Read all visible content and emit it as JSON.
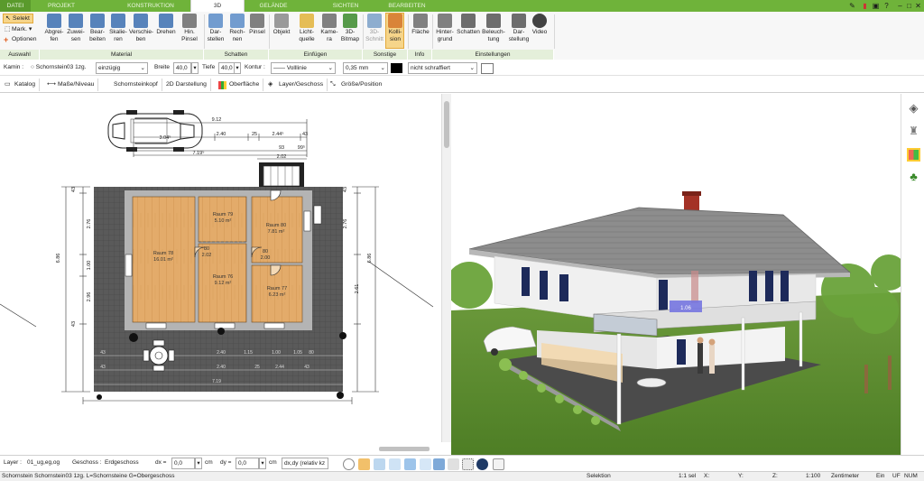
{
  "tabs": [
    "DATEI",
    "PROJEKT",
    "KONSTRUKTION",
    "3D",
    "GELÄNDE",
    "SICHTEN",
    "BEARBEITEN"
  ],
  "active_tab": "3D",
  "ribbon": {
    "auswahl": {
      "select": "Selekt",
      "mark": "Mark.",
      "options": "Optionen",
      "label": "Auswahl"
    },
    "material": {
      "label": "Material",
      "buttons": [
        "Abgrei-\nfen",
        "Zuwei-\nsen",
        "Bear-\nbeiten",
        "Skalie-\nren",
        "Verschie-\nben",
        "Drehen",
        "Hin.\nPinsel"
      ]
    },
    "schatten": {
      "label": "Schatten",
      "buttons": [
        "Dar-\nstellen",
        "Rech-\nnen",
        "Pinsel"
      ]
    },
    "einfuegen": {
      "label": "Einfügen",
      "buttons": [
        "Objekt",
        "Licht-\nquelle",
        "Kame-\nra",
        "3D-\nBitmap"
      ]
    },
    "sonstige": {
      "label": "Sonstige",
      "buttons": [
        "3D-\nSchnitt",
        "Kolli-\nsion"
      ]
    },
    "info": {
      "label": "Info",
      "buttons": [
        "Fläche"
      ]
    },
    "einstellungen": {
      "label": "Einstellungen",
      "buttons": [
        "Hinter-\ngrund",
        "Schatten",
        "Beleuch-\ntung",
        "Dar-\nstellung",
        "Video"
      ]
    }
  },
  "propbar": {
    "kamin_label": "Kamin :",
    "kamin_value": "Schornstein03 1zg.",
    "zug_value": "einzügig",
    "breite_label": "Breite",
    "breite_value": "40,0",
    "tiefe_label": "Tiefe",
    "tiefe_value": "40,0",
    "kontur_label": "Kontur :",
    "line_style": "Volllinie",
    "line_width": "0,35 mm",
    "fill": "nicht schraffiert"
  },
  "toolbar2": [
    "Katalog",
    "Maße/Niveau",
    "Schornsteinkopf",
    "2D Darstellung",
    "Oberfläche",
    "Layer/Geschoss",
    "Größe/Position"
  ],
  "plan": {
    "dims_top": [
      "9.12",
      "2.40",
      "25",
      "2.44⁵",
      "43",
      "7.19⁵",
      "93",
      "99⁵",
      "2.02"
    ],
    "car_dim": "3.04⁵",
    "rooms": [
      {
        "name": "Raum 78",
        "area": "16.01 m²"
      },
      {
        "name": "Raum 79",
        "area": "5.10 m²"
      },
      {
        "name": "Raum 80",
        "area": "7.81 m²"
      },
      {
        "name": "Raum 76",
        "area": "9.12 m²"
      },
      {
        "name": "Raum 77",
        "area": "6.23 m²"
      }
    ],
    "door_labels": [
      "80",
      "2.02",
      "80",
      "2.00"
    ],
    "dims_left": [
      "43",
      "2.76",
      "1.00",
      "2.96",
      "43",
      "6.86"
    ],
    "dims_right": [
      "43",
      "2.76",
      "6.86",
      "2.61"
    ],
    "dims_bottom": [
      "43",
      "2.40",
      "1.15",
      "1.00",
      "1.05",
      "80",
      "43",
      "2.40",
      "25",
      "2.44",
      "43",
      "7.19"
    ]
  },
  "view3d": {
    "label": "1.06"
  },
  "layerbar": {
    "layer_label": "Layer :",
    "layer_value": "01_ug,eg,og",
    "geschoss_label": "Geschoss :",
    "geschoss_value": "Erdgeschoss",
    "dx_label": "dx =",
    "dx_value": "0,0",
    "dx_unit": "cm",
    "dy_label": "dy =",
    "dy_value": "0,0",
    "dy_unit": "cm",
    "rel_value": "dx,dy (relativ kz"
  },
  "status": {
    "left": "Schornstein Schornstein03 1zg. L=Schornsteine G=Obergeschoss",
    "mode": "Selektion",
    "scale_sel": "1:1 sel",
    "x": "X:",
    "y": "Y:",
    "z": "Z:",
    "scale": "1:100",
    "unit": "Zentimeter",
    "ein": "Ein",
    "uf": "UF",
    "num": "NUM"
  }
}
